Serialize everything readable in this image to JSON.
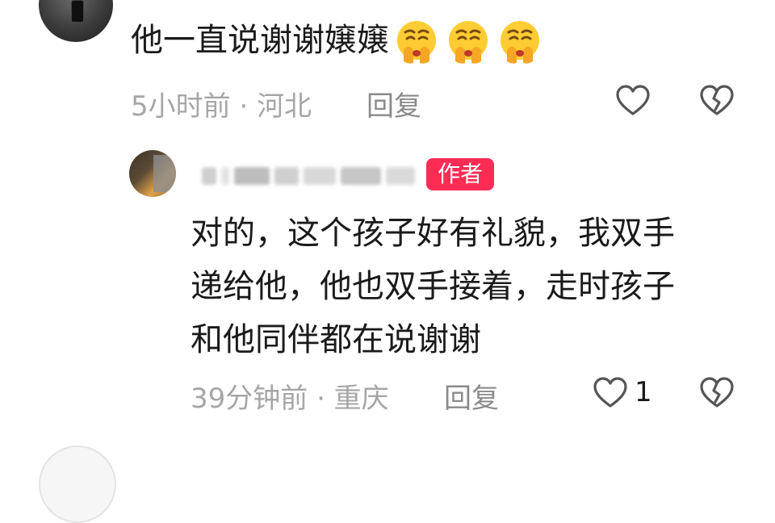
{
  "comment": {
    "text": "他一直说谢谢嬢嬢",
    "emojis": [
      "hands-over-mouth-emoji",
      "hands-over-mouth-emoji",
      "hands-over-mouth-emoji"
    ],
    "meta": "5小时前 · 河北",
    "reply_label": "回复"
  },
  "reply": {
    "author_badge": "作者",
    "lines": [
      "对的，这个孩子好有礼貌，我双手",
      "递给他，他也双手接着，走时孩子",
      "和他同伴都在说谢谢"
    ],
    "meta": "39分钟前 · 重庆",
    "reply_label": "回复",
    "like_count": "1"
  },
  "colors": {
    "badge": "#fe2c55",
    "meta_text": "#a6a6a6",
    "icon_stroke": "#555555"
  },
  "icons": [
    "heart-outline-icon",
    "broken-heart-icon"
  ]
}
